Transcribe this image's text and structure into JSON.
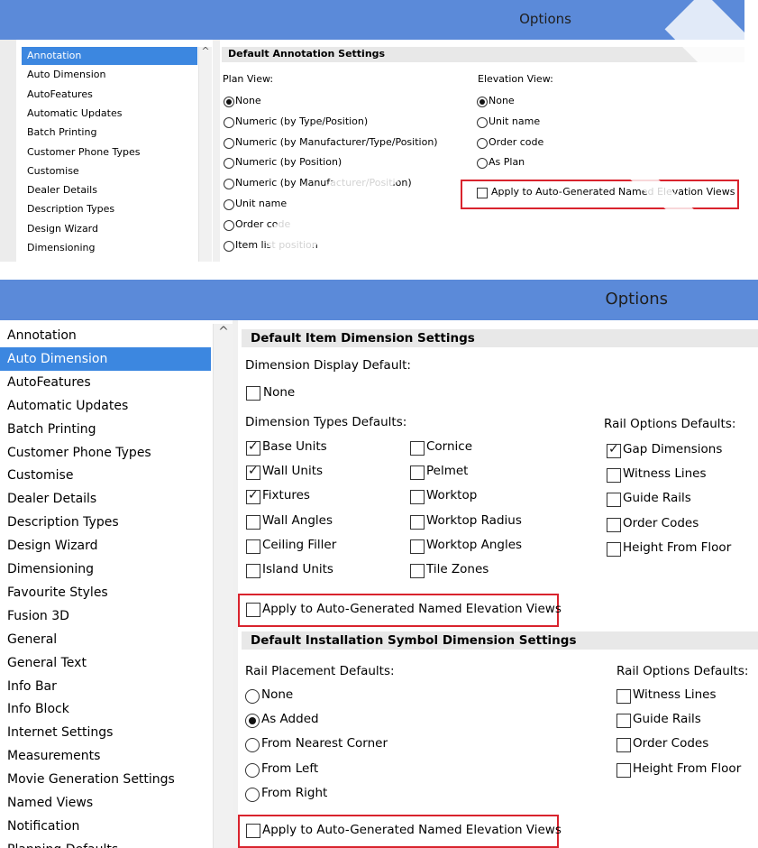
{
  "top": {
    "title": "Options",
    "nav": [
      "Annotation",
      "Auto Dimension",
      "AutoFeatures",
      "Automatic Updates",
      "Batch Printing",
      "Customer Phone Types",
      "Customise",
      "Dealer Details",
      "Description Types",
      "Design Wizard",
      "Dimensioning"
    ],
    "selected_index": 0,
    "section_title": "Default Annotation Settings",
    "plan_label": "Plan View:",
    "plan_options": [
      "None",
      "Numeric (by Type/Position)",
      "Numeric (by Manufacturer/Type/Position)",
      "Numeric (by Position)",
      "Numeric (by Manufacturer/Position)",
      "Unit name",
      "Order code",
      "Item list position"
    ],
    "plan_selected": 0,
    "elevation_label": "Elevation View:",
    "elevation_options": [
      "None",
      "Unit name",
      "Order code",
      "As Plan"
    ],
    "elevation_selected": 0,
    "apply_label": "Apply to Auto-Generated Named Elevation Views",
    "apply_checked": false
  },
  "bottom": {
    "title": "Options",
    "nav": [
      "Annotation",
      "Auto Dimension",
      "AutoFeatures",
      "Automatic Updates",
      "Batch Printing",
      "Customer Phone Types",
      "Customise",
      "Dealer Details",
      "Description Types",
      "Design Wizard",
      "Dimensioning",
      "Favourite Styles",
      "Fusion 3D",
      "General",
      "General Text",
      "Info Bar",
      "Info Block",
      "Internet Settings",
      "Measurements",
      "Movie Generation Settings",
      "Named Views",
      "Notification",
      "Planning Defaults"
    ],
    "selected_index": 1,
    "item_section": {
      "title": "Default Item Dimension Settings",
      "display_default_label": "Dimension Display Default:",
      "none_label": "None",
      "none_checked": false,
      "types_label": "Dimension Types Defaults:",
      "types_col1": [
        {
          "label": "Base Units",
          "checked": true
        },
        {
          "label": "Wall Units",
          "checked": true
        },
        {
          "label": "Fixtures",
          "checked": true
        },
        {
          "label": "Wall Angles",
          "checked": false
        },
        {
          "label": "Ceiling Filler",
          "checked": false
        },
        {
          "label": "Island Units",
          "checked": false
        }
      ],
      "types_col2": [
        {
          "label": "Cornice",
          "checked": false
        },
        {
          "label": "Pelmet",
          "checked": false
        },
        {
          "label": "Worktop",
          "checked": false
        },
        {
          "label": "Worktop Radius",
          "checked": false
        },
        {
          "label": "Worktop Angles",
          "checked": false
        },
        {
          "label": "Tile Zones",
          "checked": false
        }
      ],
      "rail_label": "Rail Options Defaults:",
      "rail_options": [
        {
          "label": "Gap Dimensions",
          "checked": true
        },
        {
          "label": "Witness Lines",
          "checked": false
        },
        {
          "label": "Guide Rails",
          "checked": false
        },
        {
          "label": "Order Codes",
          "checked": false
        },
        {
          "label": "Height From Floor",
          "checked": false
        }
      ],
      "apply_label": "Apply to Auto-Generated Named Elevation Views",
      "apply_checked": false
    },
    "install_section": {
      "title": "Default Installation Symbol Dimension Settings",
      "placement_label": "Rail Placement Defaults:",
      "placement_options": [
        "None",
        "As Added",
        "From Nearest Corner",
        "From Left",
        "From Right"
      ],
      "placement_selected": 1,
      "rail_label": "Rail Options Defaults:",
      "rail_options": [
        {
          "label": "Witness Lines",
          "checked": false
        },
        {
          "label": "Guide Rails",
          "checked": false
        },
        {
          "label": "Order Codes",
          "checked": false
        },
        {
          "label": "Height From Floor",
          "checked": false
        }
      ],
      "apply_label": "Apply to Auto-Generated Named Elevation Views",
      "apply_checked": false
    }
  },
  "colors": {
    "titlebar": "#5b8ad9",
    "selection": "#3c87e0",
    "highlight_box": "#d9232d"
  }
}
